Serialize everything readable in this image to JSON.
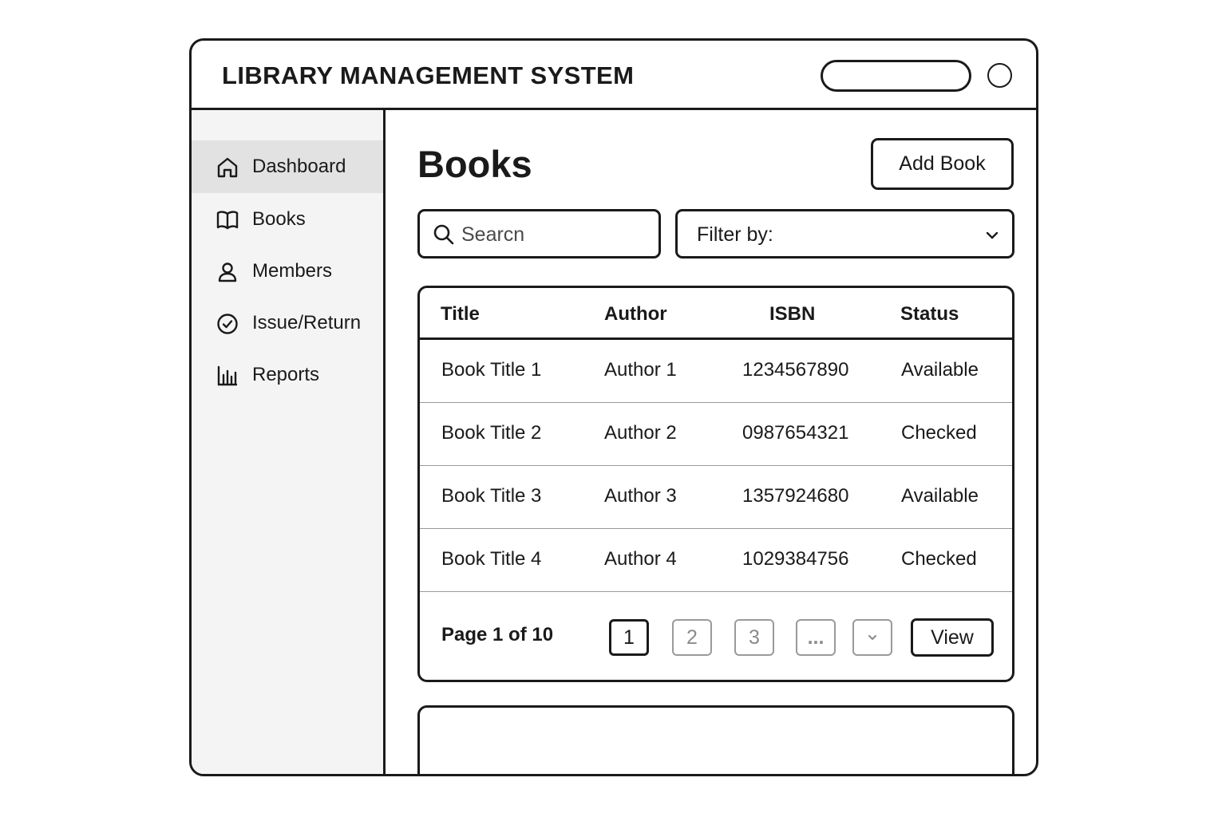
{
  "app": {
    "title": "LIBRARY MANAGEMENT SYSTEM",
    "colors": {
      "border": "#1a1a1a",
      "sidebar_bg": "#f4f4f4",
      "active_item_bg": "#e2e2e2",
      "muted": "#9a9a9a"
    }
  },
  "header": {
    "pill_icon": "pill-search-bar",
    "circle_icon": "profile-circle"
  },
  "sidebar": {
    "items": [
      {
        "label": "Dashboard",
        "icon": "home-icon",
        "active": true
      },
      {
        "label": "Books",
        "icon": "book-icon",
        "active": false
      },
      {
        "label": "Members",
        "icon": "user-icon",
        "active": false
      },
      {
        "label": "Issue/Return",
        "icon": "check-circle-icon",
        "active": false
      },
      {
        "label": "Reports",
        "icon": "bar-chart-icon",
        "active": false
      }
    ]
  },
  "main": {
    "page_title": "Books",
    "add_button": "Add Book",
    "search": {
      "placeholder": "Searcn",
      "value": "",
      "icon": "search-icon"
    },
    "filter": {
      "label": "Filter by:",
      "icon": "chevron-down-icon"
    },
    "table": {
      "columns": [
        "Title",
        "Author",
        "ISBN",
        "Status"
      ],
      "rows": [
        [
          "Book Title 1",
          "Author 1",
          "1234567890",
          "Available"
        ],
        [
          "Book Title 2",
          "Author 2",
          "0987654321",
          "Checked"
        ],
        [
          "Book Title 3",
          "Author 3",
          "1357924680",
          "Available"
        ],
        [
          "Book Title 4",
          "Author 4",
          "1029384756",
          "Checked"
        ]
      ]
    },
    "pagination": {
      "label": "Page 1 of 10",
      "pages": [
        "1",
        "2",
        "3",
        "..."
      ],
      "current": "1",
      "chevron_icon": "chevron-down-icon",
      "view_button": "View"
    }
  }
}
